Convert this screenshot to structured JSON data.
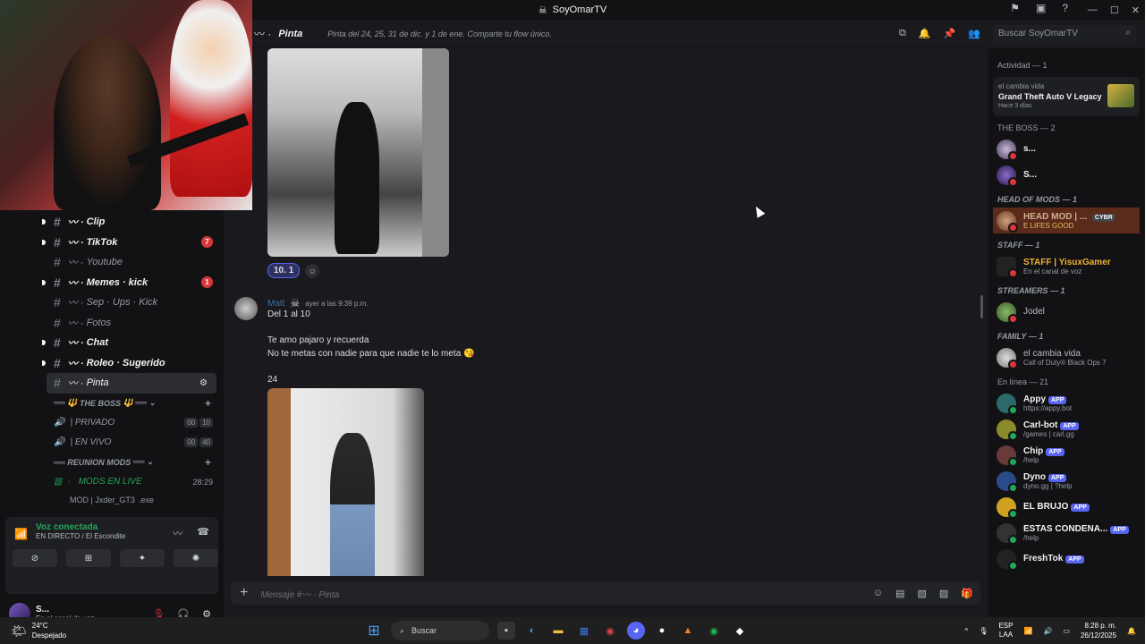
{
  "window": {
    "title": "SoyOmarTV"
  },
  "header": {
    "channel": "Pinta",
    "topic": "Pinta del 24, 25, 31 de dic. y 1 de ene. Comparte tu flow único.",
    "search_placeholder": "Buscar SoyOmarTV"
  },
  "sidebar": {
    "channels": [
      {
        "name": "Clip",
        "unread": true
      },
      {
        "name": "TikTok",
        "unread": true,
        "badge": "7"
      },
      {
        "name": "Youtube",
        "unread": false
      },
      {
        "name": "Memes · kick",
        "unread": true,
        "badge": "1"
      },
      {
        "name": "Sep · Ups · Kick",
        "unread": false
      },
      {
        "name": "Fotos",
        "unread": false
      },
      {
        "name": "Chat",
        "unread": true
      },
      {
        "name": "Roleo · Sugerido",
        "unread": true
      },
      {
        "name": "Pinta",
        "unread": false,
        "active": true
      }
    ],
    "cat_boss": "THE BOSS",
    "voice_boss": [
      {
        "name": "| PRIVADO",
        "c1": "00",
        "c2": "10"
      },
      {
        "name": "| EN VIVO",
        "c1": "00",
        "c2": "40"
      }
    ],
    "cat_reunion": "REUNION MODS",
    "live_channel": {
      "name": "MODS EN LIVE",
      "time": "28:29"
    },
    "live_user": "MOD | Jxder_GT3",
    "live_user_tag": ".exe"
  },
  "voice": {
    "title": "Voz conectada",
    "sub": "EN DIRECTO",
    "sub_channel": "/ El Escondite"
  },
  "user": {
    "name": "S...",
    "status": "En el canal de voz"
  },
  "chat": {
    "reaction_count": "1",
    "reaction_emoji": "10.",
    "message": {
      "author": "Matt",
      "timestamp": "ayer a las 9:39 p.m.",
      "lines": [
        "Del 1 al 10",
        "",
        "Te amo pajaro y recuerda",
        "No te metas con nadie para que nadie te lo meta",
        "",
        "24"
      ]
    },
    "composer_placeholder": "Mensaje #",
    "composer_channel": "Pinta"
  },
  "members": {
    "activity_header": "Actividad — 1",
    "activity": {
      "user": "el cambia vida",
      "game": "Grand Theft Auto V Legacy",
      "time": "Hace 3 días"
    },
    "groups": [
      {
        "title": "THE BOSS",
        "count": "— 2",
        "italic": false,
        "items": [
          {
            "name": "s...",
            "status": ""
          },
          {
            "name": "S...",
            "status": ""
          }
        ]
      },
      {
        "title": "HEAD OF MODS",
        "count": "— 1",
        "italic": true,
        "items": [
          {
            "name": "HEAD MOD | ...",
            "status": "E LIFES GOOD",
            "tag": "CYBR"
          }
        ]
      },
      {
        "title": "STAFF",
        "count": "— 1",
        "italic": true,
        "items": [
          {
            "name": "STAFF | YisuxGamer",
            "status": "En el canal de voz"
          }
        ]
      },
      {
        "title": "STREAMERS",
        "count": "— 1",
        "italic": true,
        "items": [
          {
            "name": "Jodel",
            "status": ""
          }
        ]
      },
      {
        "title": "FAMILY",
        "count": "— 1",
        "italic": true,
        "items": [
          {
            "name": "el cambia vida",
            "status": "Call of Duty® Black Ops 7"
          }
        ]
      }
    ],
    "online_header": "En línea — 21",
    "online": [
      {
        "name": "Appy",
        "status": "https://appy.bot",
        "app": "APP"
      },
      {
        "name": "Carl-bot",
        "status": "/games | carl.gg",
        "app": "APP"
      },
      {
        "name": "Chip",
        "status": "/help",
        "app": "APP"
      },
      {
        "name": "Dyno",
        "status": "dyno.gg | ?help",
        "app": "APP"
      },
      {
        "name": "EL BRUJO",
        "status": "",
        "app": "APP"
      },
      {
        "name": "ESTAS CONDENA...",
        "status": "/help",
        "app": "APP"
      },
      {
        "name": "FreshTok",
        "status": "",
        "app": "APP"
      }
    ]
  },
  "taskbar": {
    "temp": "24°C",
    "weather": "Despejado",
    "search": "Buscar",
    "lang1": "ESP",
    "lang2": "LAA",
    "time": "8:28 p. m.",
    "date": "26/12/2025"
  }
}
